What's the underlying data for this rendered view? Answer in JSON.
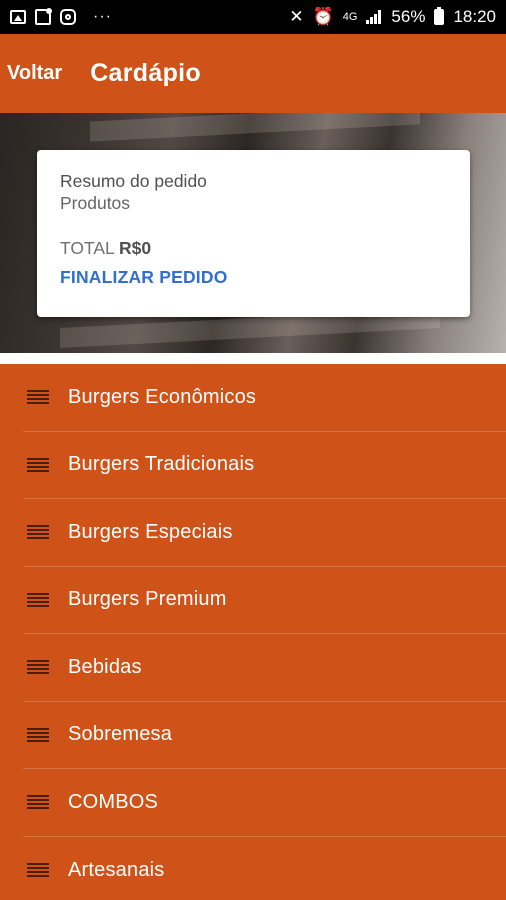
{
  "status_bar": {
    "dots": "···",
    "network": "4G",
    "battery": "56%",
    "time": "18:20"
  },
  "app_bar": {
    "back_label": "Voltar",
    "title": "Cardápio"
  },
  "summary_card": {
    "title": "Resumo do pedido",
    "subtitle": "Produtos",
    "total_label": "TOTAL",
    "total_value": "R$0",
    "finish_label": "FINALIZAR PEDIDO"
  },
  "menu": {
    "items": [
      {
        "label": "Burgers Econômicos"
      },
      {
        "label": "Burgers Tradicionais"
      },
      {
        "label": "Burgers Especiais"
      },
      {
        "label": "Burgers Premium"
      },
      {
        "label": "Bebidas"
      },
      {
        "label": "Sobremesa"
      },
      {
        "label": "COMBOS"
      },
      {
        "label": "Artesanais"
      }
    ]
  },
  "colors": {
    "primary": "#cf5318",
    "link": "#2f6fd0",
    "status_bar": "#000000"
  }
}
